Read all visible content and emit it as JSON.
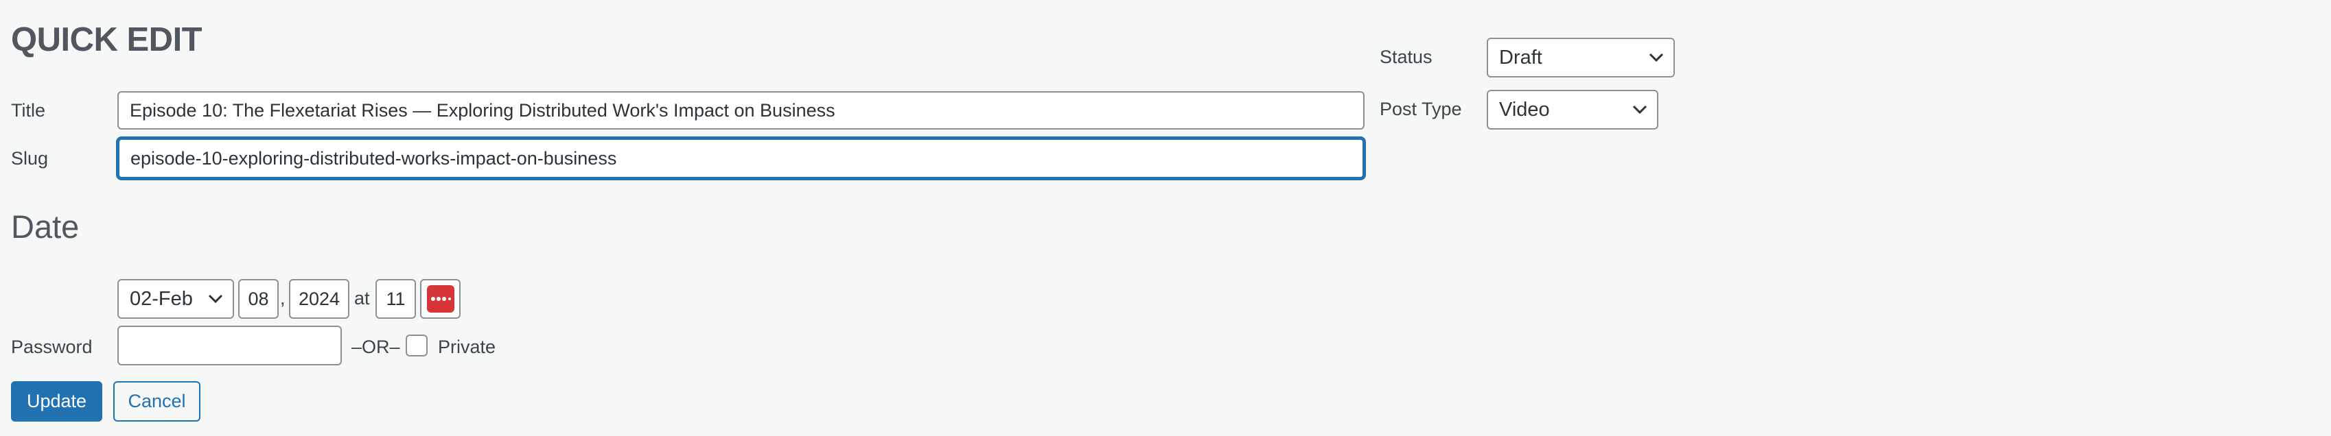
{
  "form": {
    "heading": "QUICK EDIT",
    "title_label": "Title",
    "title_value": "Episode 10: The Flexetariat Rises — Exploring Distributed Work's Impact on Business",
    "slug_label": "Slug",
    "slug_value": "episode-10-exploring-distributed-works-impact-on-business",
    "date_heading": "Date",
    "date": {
      "month": "02-Feb",
      "day": "08",
      "comma": ",",
      "year": "2024",
      "at": "at",
      "hour": "11",
      "minute_icon": "ellipsis-icon"
    },
    "password_label": "Password",
    "password_value": "",
    "or_text": "–OR–",
    "private_label": "Private",
    "private_checked": false
  },
  "side": {
    "status_label": "Status",
    "status_value": "Draft",
    "post_type_label": "Post Type",
    "post_type_value": "Video"
  },
  "buttons": {
    "update": "Update",
    "cancel": "Cancel"
  },
  "colors": {
    "primary": "#2271b1",
    "danger": "#d63638",
    "background": "#f6f7f7"
  }
}
